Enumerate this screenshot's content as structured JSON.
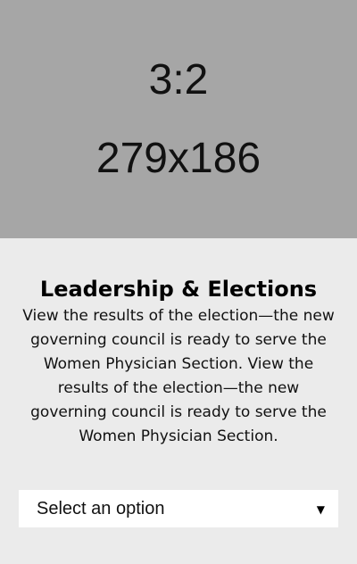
{
  "hero": {
    "ratio": "3:2",
    "size": "279x186",
    "background": "#a6a6a6"
  },
  "content": {
    "title": "Leadership & Elections",
    "description": "View the results of the election—the new governing council is ready to serve the Women Physician Section. View the results of the election—the new governing council is ready to serve the Women Physician Section."
  },
  "select": {
    "value": "Select an option",
    "arrow_icon": "triangle-down-icon",
    "arrow_glyph": "▼"
  },
  "colors": {
    "page_background": "#ebebeb",
    "select_background": "#ffffff"
  }
}
